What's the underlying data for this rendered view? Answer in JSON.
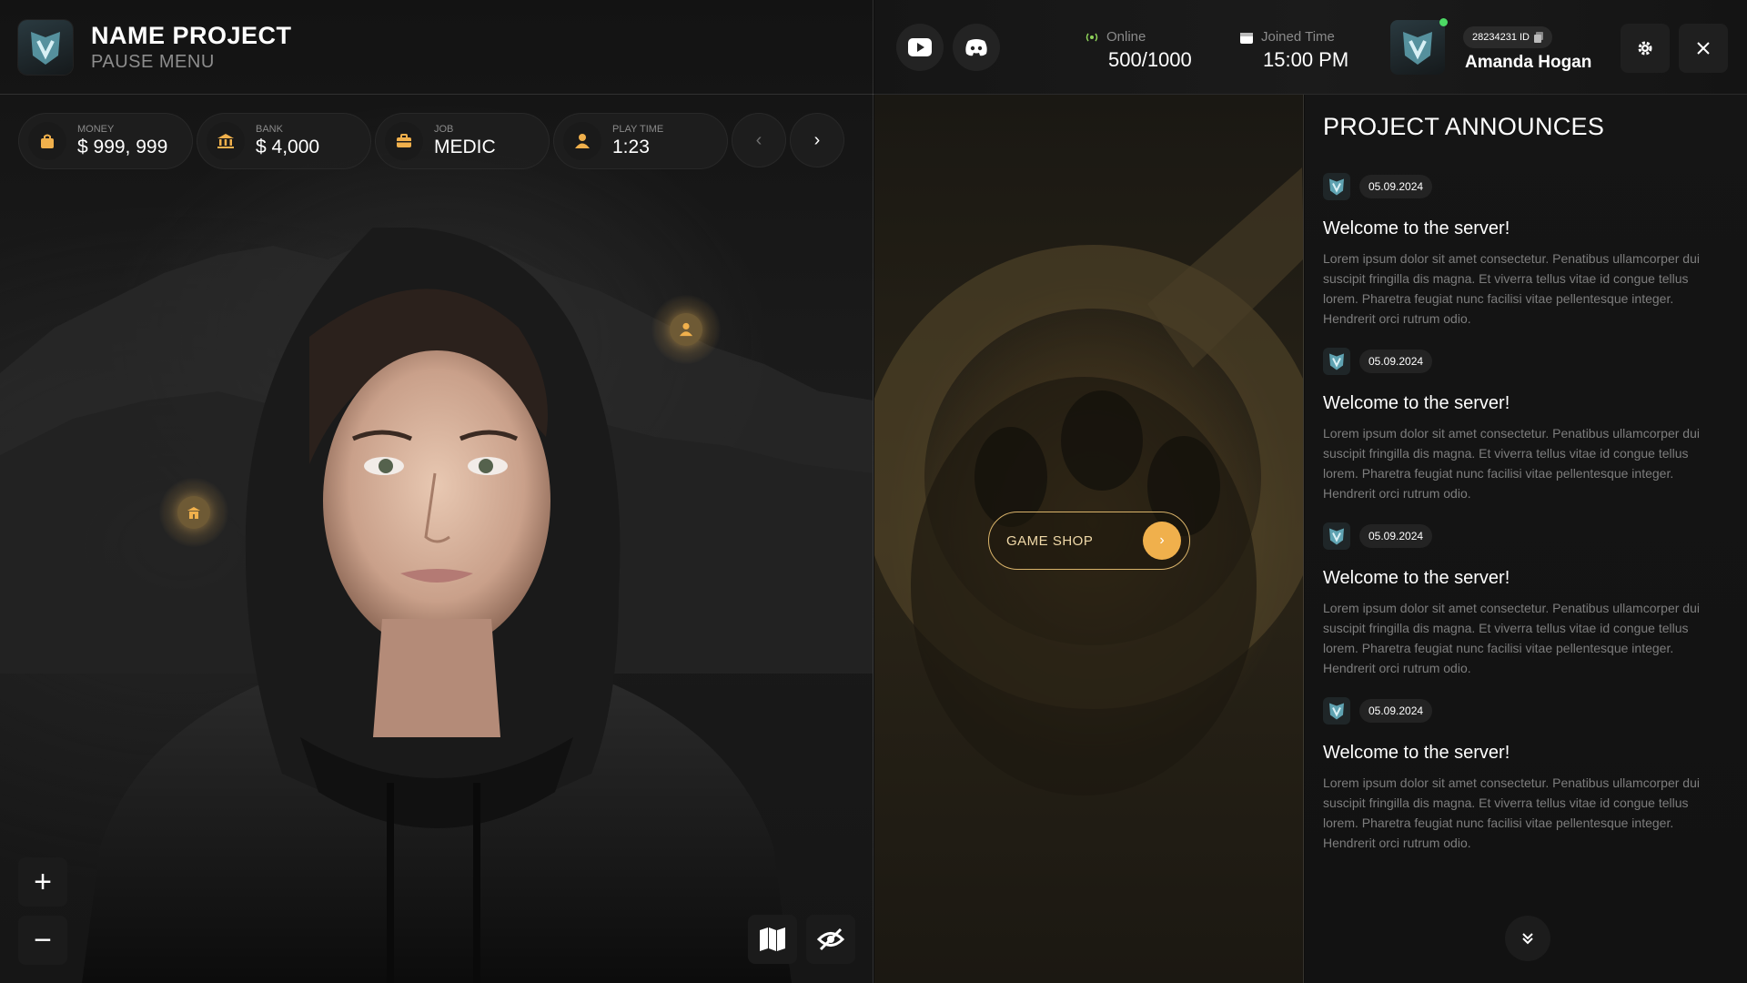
{
  "brand": {
    "title": "NAME PROJECT",
    "subtitle": "PAUSE MENU"
  },
  "stats": [
    {
      "label": "MONEY",
      "value": "$ 999, 999",
      "icon": "bag-icon"
    },
    {
      "label": "BANK",
      "value": "$ 4,000",
      "icon": "bank-icon"
    },
    {
      "label": "JOB",
      "value": "MEDIC",
      "icon": "briefcase-icon"
    },
    {
      "label": "PLAY TIME",
      "value": "1:23",
      "icon": "person-icon"
    }
  ],
  "header": {
    "online_label": "Online",
    "online_value": "500/1000",
    "joined_label": "Joined Time",
    "joined_value": "15:00 PM",
    "user_id": "28234231 ID",
    "user_name": "Amanda Hogan"
  },
  "shop": {
    "label": "GAME SHOP"
  },
  "announces": {
    "title": "PROJECT ANNOUNCES",
    "items": [
      {
        "date": "05.09.2024",
        "heading": "Welcome to the server!",
        "body": "Lorem ipsum dolor sit amet consectetur. Penatibus ullamcorper dui suscipit fringilla dis magna. Et viverra tellus vitae id congue tellus lorem. Pharetra feugiat nunc facilisi vitae pellentesque integer. Hendrerit orci rutrum odio."
      },
      {
        "date": "05.09.2024",
        "heading": "Welcome to the server!",
        "body": "Lorem ipsum dolor sit amet consectetur. Penatibus ullamcorper dui suscipit fringilla dis magna. Et viverra tellus vitae id congue tellus lorem. Pharetra feugiat nunc facilisi vitae pellentesque integer. Hendrerit orci rutrum odio."
      },
      {
        "date": "05.09.2024",
        "heading": "Welcome to the server!",
        "body": "Lorem ipsum dolor sit amet consectetur. Penatibus ullamcorper dui suscipit fringilla dis magna. Et viverra tellus vitae id congue tellus lorem. Pharetra feugiat nunc facilisi vitae pellentesque integer. Hendrerit orci rutrum odio."
      },
      {
        "date": "05.09.2024",
        "heading": "Welcome to the server!",
        "body": "Lorem ipsum dolor sit amet consectetur. Penatibus ullamcorper dui suscipit fringilla dis magna. Et viverra tellus vitae id congue tellus lorem. Pharetra feugiat nunc facilisi vitae pellentesque integer. Hendrerit orci rutrum odio."
      }
    ]
  },
  "colors": {
    "accent": "#f0b04c",
    "accent_border": "#d9b36a",
    "online_green": "#4cd964",
    "muted_text": "#7d7d7d"
  },
  "icons": {
    "youtube": "youtube-icon",
    "discord": "discord-icon",
    "signal": "signal-icon",
    "calendar": "calendar-icon",
    "copy": "copy-icon",
    "settings": "gear-icon",
    "close": "close-icon",
    "map": "map-icon",
    "hide": "eye-off-icon",
    "zoom_in": "plus-icon",
    "zoom_out": "minus-icon",
    "scroll": "double-chevron-down-icon"
  }
}
